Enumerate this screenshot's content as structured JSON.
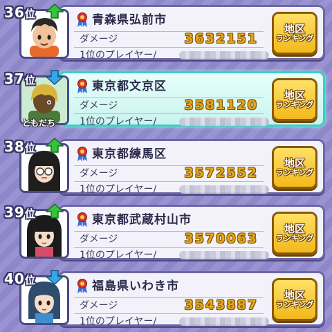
{
  "rank_suffix": "位",
  "labels": {
    "damage": "ダメージ",
    "player": "1位のプレイヤー/",
    "button_line1": "地区",
    "button_line2": "ランキング"
  },
  "colors": {
    "up_arrow": "#35c23c",
    "down_arrow": "#35a6e6",
    "highlight_border": "#39d0c3",
    "damage_value": "#e7a51a",
    "button": "#f2b91c"
  },
  "rows": [
    {
      "rank": "36",
      "trend": "up",
      "trend_icon": "up-arrow-icon",
      "city": "青森県弘前市",
      "damage": "3632151",
      "avatar": "boy-avatar",
      "highlighted": false
    },
    {
      "rank": "37",
      "trend": "down",
      "trend_icon": "down-arrow-icon",
      "city": "東京都文京区",
      "damage": "3581120",
      "avatar": "tomodachi-avatar",
      "avatar_caption": "ともだち",
      "highlighted": true
    },
    {
      "rank": "38",
      "trend": "up",
      "trend_icon": "up-arrow-icon",
      "city": "東京都練馬区",
      "damage": "3572552",
      "avatar": "glasses-girl-avatar",
      "highlighted": false
    },
    {
      "rank": "39",
      "trend": "up",
      "trend_icon": "up-arrow-icon",
      "city": "東京都武蔵村山市",
      "damage": "3570063",
      "avatar": "long-hair-girl-avatar",
      "highlighted": false
    },
    {
      "rank": "40",
      "trend": "down",
      "trend_icon": "down-arrow-icon",
      "city": "福島県いわき市",
      "damage": "3543887",
      "avatar": "braid-girl-avatar",
      "highlighted": false
    }
  ]
}
